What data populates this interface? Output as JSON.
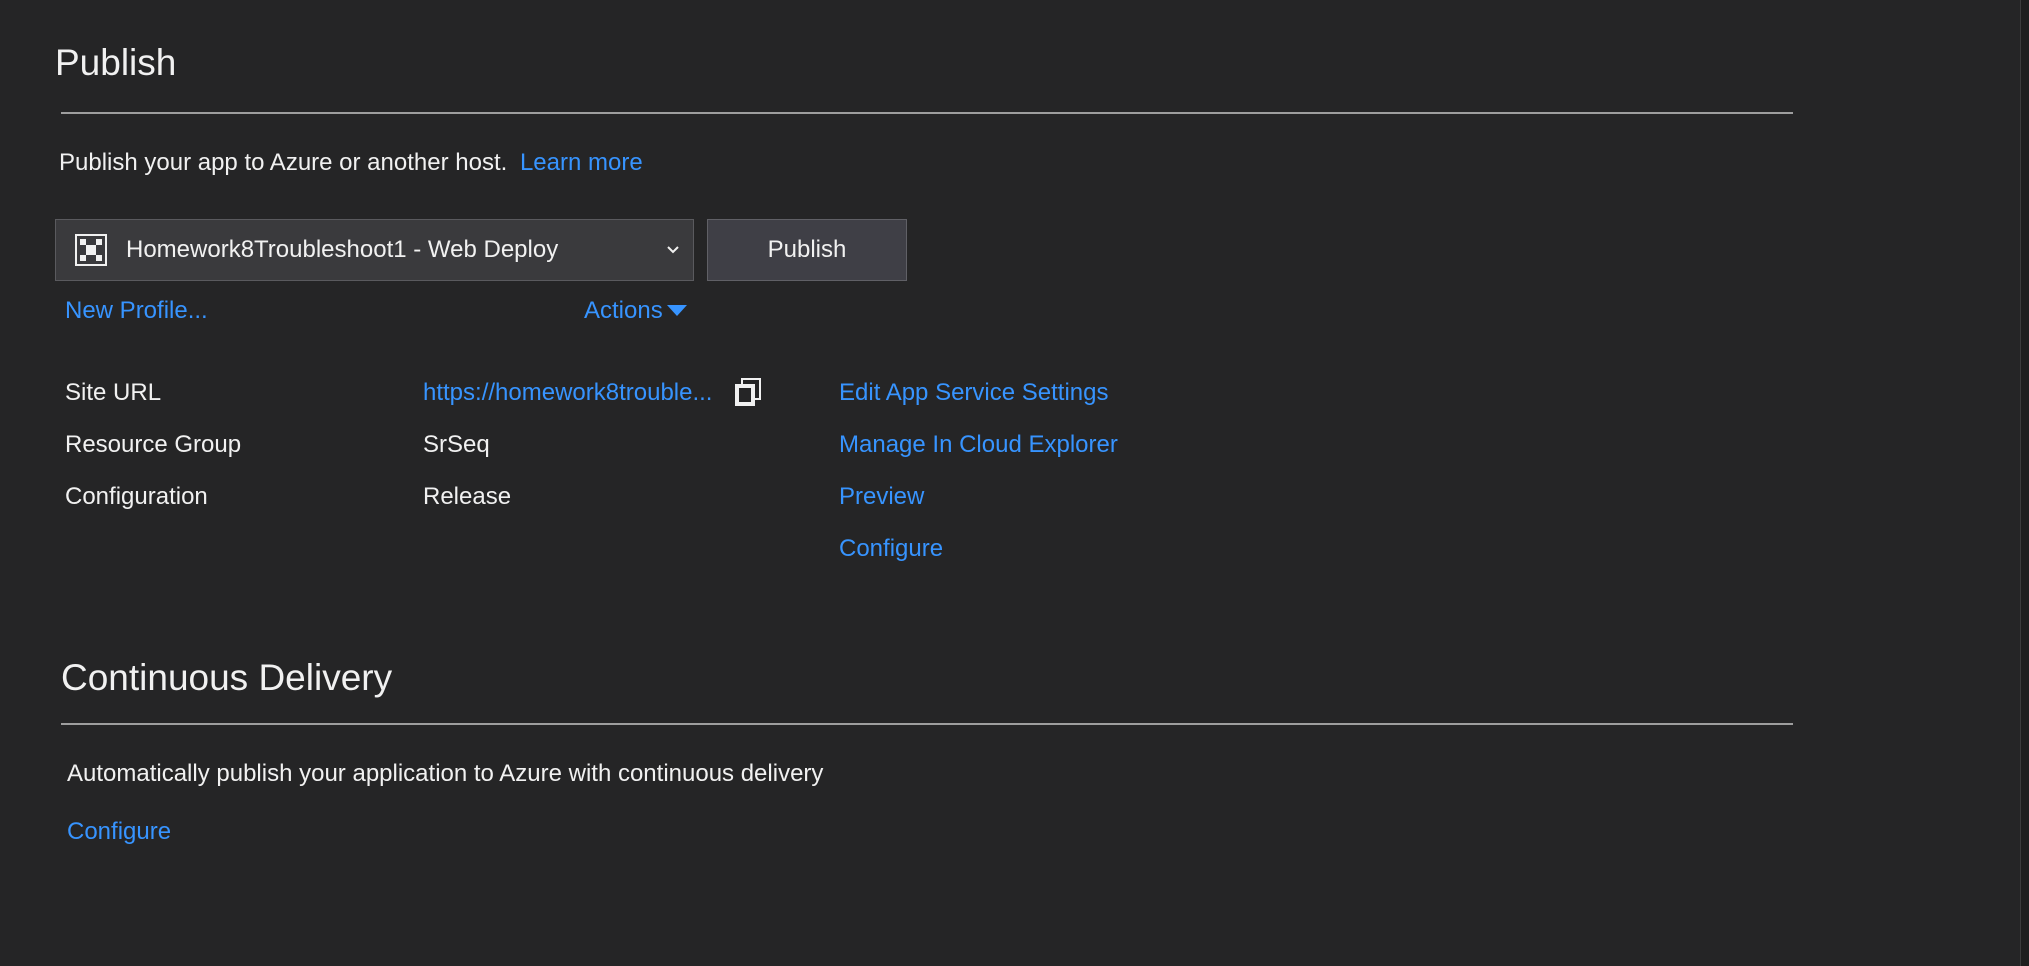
{
  "publish": {
    "title": "Publish",
    "intro_text": "Publish your app to Azure or another host.",
    "learn_more": "Learn more",
    "profile_dropdown": {
      "selected": "Homework8Troubleshoot1 - Web Deploy",
      "icon": "web-deploy-profile-icon"
    },
    "publish_button": "Publish",
    "new_profile": "New Profile...",
    "actions": "Actions",
    "details": [
      {
        "label": "Site URL",
        "value": "https://homework8trouble..."
      },
      {
        "label": "Resource Group",
        "value": "SrSeq"
      },
      {
        "label": "Configuration",
        "value": "Release"
      }
    ],
    "links": [
      "Edit App Service Settings",
      "Manage In Cloud Explorer",
      "Preview",
      "Configure"
    ]
  },
  "continuous_delivery": {
    "title": "Continuous Delivery",
    "description": "Automatically publish your application to Azure with continuous delivery",
    "configure": "Configure"
  },
  "colors": {
    "background": "#252526",
    "link": "#3794ff",
    "text": "#f1f1f1",
    "rule": "#9e9e9e"
  }
}
